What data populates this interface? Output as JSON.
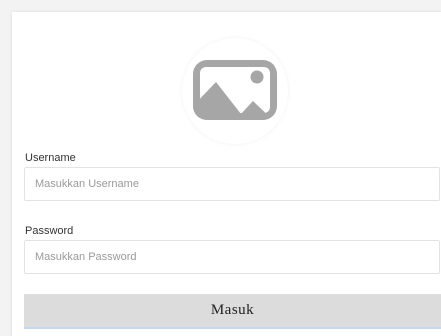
{
  "form": {
    "logo_icon": "image-placeholder-icon",
    "username_label": "Username",
    "username_placeholder": "Masukkan Username",
    "password_label": "Password",
    "password_placeholder": "Masukkan Password",
    "submit_label": "Masuk"
  },
  "colors": {
    "icon_gray": "#a6a6a6",
    "button_bg": "#dcdcdc",
    "button_underline": "#c8d6ef"
  }
}
